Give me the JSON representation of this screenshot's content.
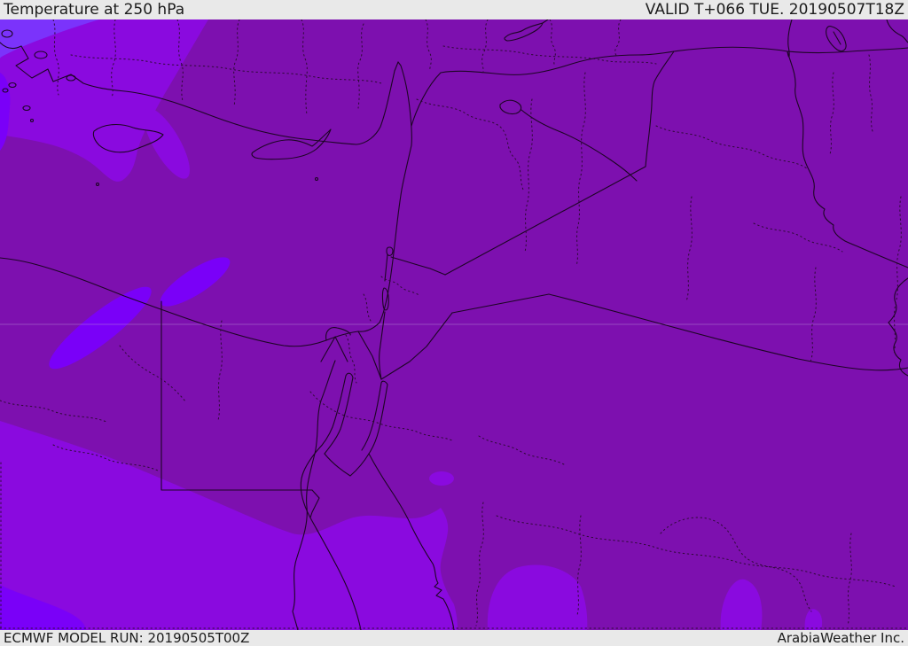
{
  "header": {
    "title": "Temperature at 250 hPa",
    "valid": "VALID T+066 TUE. 20190507T18Z"
  },
  "footer": {
    "model_run": "ECMWF MODEL RUN: 20190505T00Z",
    "credit": "ArabiaWeather Inc."
  },
  "map": {
    "region": "Middle East",
    "palette": {
      "band_main": "#7d10af",
      "band_cold": "#8a0adf",
      "band_colder": "#7a00f8",
      "band_coldest": "#7b33fb",
      "border": "#1d0524",
      "admin": "#2e0a36",
      "grid": "#b98fd6",
      "bar_bg": "#e9e9e9",
      "bar_text": "#1c1c1c"
    }
  }
}
